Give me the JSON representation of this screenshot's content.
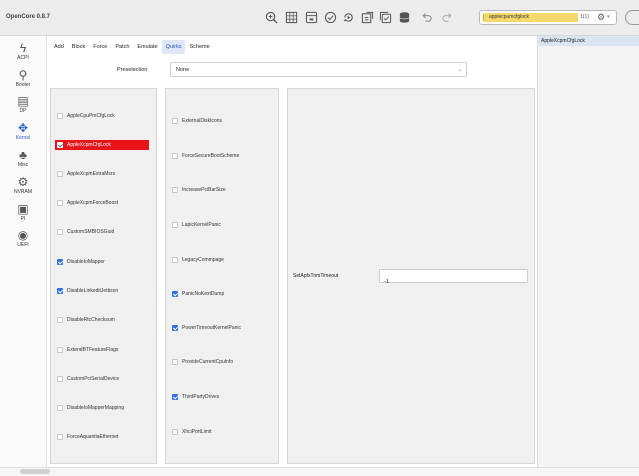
{
  "app": {
    "title": "OpenCore 0.8.7"
  },
  "toolbar": {
    "icons": [
      "magnifier-icon",
      "grid-icon",
      "save-icon",
      "check-circle-icon",
      "refresh-icon",
      "import-icon",
      "copy-icon",
      "database-icon",
      "undo-icon",
      "redo-icon"
    ],
    "search": {
      "query": "applecpumcfglock",
      "count": "1(1)"
    }
  },
  "right_panel": {
    "result": "AppleXcpmCfgLock"
  },
  "sidebar": {
    "items": [
      {
        "label": "ACPI",
        "icon": "acpi-icon"
      },
      {
        "label": "Booter",
        "icon": "booter-icon"
      },
      {
        "label": "DP",
        "icon": "device-properties-icon"
      },
      {
        "label": "Kernel",
        "icon": "kernel-icon",
        "active": true
      },
      {
        "label": "Misc",
        "icon": "misc-icon"
      },
      {
        "label": "NVRAM",
        "icon": "nvram-icon"
      },
      {
        "label": "PI",
        "icon": "platforminfo-icon"
      },
      {
        "label": "UEFI",
        "icon": "uefi-icon"
      }
    ]
  },
  "tabs": [
    {
      "label": "Add"
    },
    {
      "label": "Block"
    },
    {
      "label": "Force"
    },
    {
      "label": "Patch"
    },
    {
      "label": "Emulate"
    },
    {
      "label": "Quirks",
      "active": true
    },
    {
      "label": "Scheme"
    }
  ],
  "preselection": {
    "label": "Preselection",
    "value": "None"
  },
  "column1": [
    {
      "label": "AppleCpuPmCfgLock",
      "checked": false
    },
    {
      "label": "AppleXcpmCfgLock",
      "checked": true,
      "selected": true
    },
    {
      "label": "AppleXcpmExtraMsrs",
      "checked": false
    },
    {
      "label": "AppleXcpmForceBoost",
      "checked": false
    },
    {
      "label": "CustomSMBIOSGuid",
      "checked": false
    },
    {
      "label": "DisableIoMapper",
      "checked": true
    },
    {
      "label": "DisableLinkeditJettison",
      "checked": true
    },
    {
      "label": "DisableRtcChecksum",
      "checked": false
    },
    {
      "label": "ExtendBTFeatureFlags",
      "checked": false
    },
    {
      "label": "CustomPciSerialDevice",
      "checked": false
    },
    {
      "label": "DisableIoMapperMapping",
      "checked": false
    },
    {
      "label": "ForceAquantiaEthernet",
      "checked": false
    }
  ],
  "column2": [
    {
      "label": "ExternalDiskIcons",
      "checked": false
    },
    {
      "label": "ForceSecureBootScheme",
      "checked": false
    },
    {
      "label": "IncreasePciBarSize",
      "checked": false
    },
    {
      "label": "LapicKernelPanic",
      "checked": false
    },
    {
      "label": "LegacyCommpage",
      "checked": false
    },
    {
      "label": "PanicNoKextDump",
      "checked": true
    },
    {
      "label": "PowerTimeoutKernelPanic",
      "checked": true
    },
    {
      "label": "ProvideCurrentCpuInfo",
      "checked": false
    },
    {
      "label": "ThirdPartyDrives",
      "checked": true
    },
    {
      "label": "XhciPortLimit",
      "checked": false
    }
  ],
  "column3": {
    "field_label": "SetApfsTrimTimeout",
    "field_value": "-1"
  }
}
